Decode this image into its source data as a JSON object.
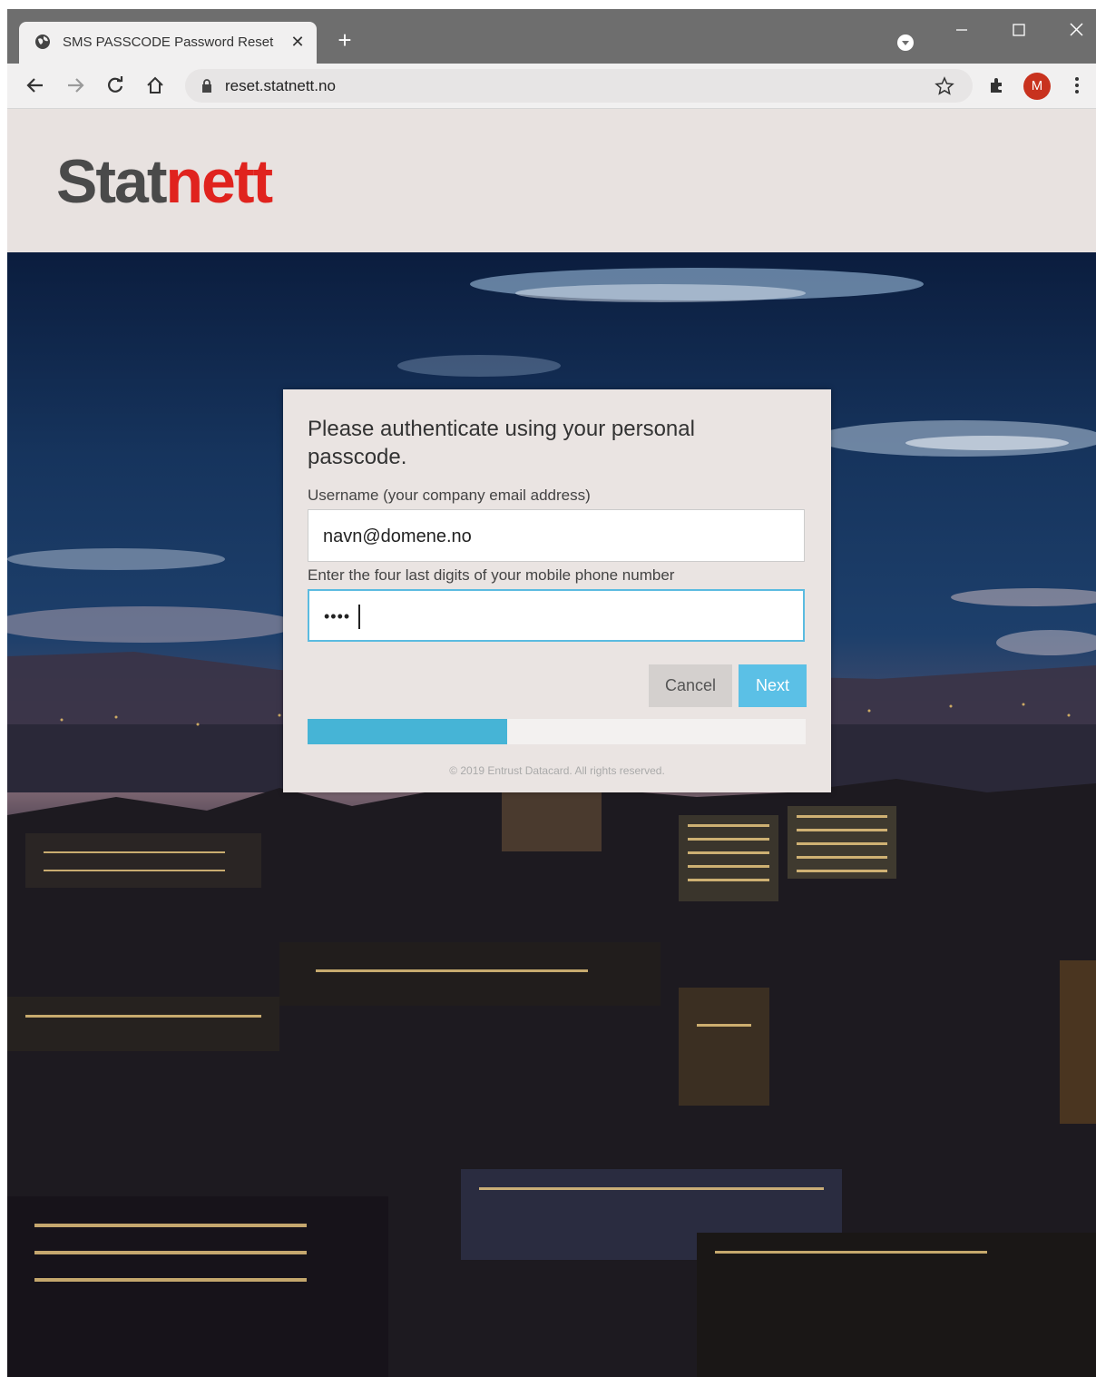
{
  "browser": {
    "tab_title": "SMS PASSCODE Password Reset",
    "tab_close": "✕",
    "new_tab": "+",
    "url": "reset.statnett.no",
    "profile_initial": "M",
    "profile_color": "#c8321e"
  },
  "header": {
    "logo_part1": "Stat",
    "logo_part2": "nett",
    "logo_colors": {
      "primary": "#4a4a4a",
      "accent": "#e0231e"
    }
  },
  "dialog": {
    "title": "Please authenticate using your personal passcode.",
    "username_label": "Username (your company email address)",
    "username_value": "navn@domene.no",
    "digits_label": "Enter the four last digits of your mobile phone number",
    "digits_masked": "••••",
    "cancel_label": "Cancel",
    "next_label": "Next",
    "progress_fraction": 0.4,
    "copyright": "© 2019 Entrust Datacard. All rights reserved."
  },
  "colors": {
    "accent": "#5bc0e6",
    "progress": "#46b4d6",
    "dialog_bg": "#eae4e2"
  }
}
